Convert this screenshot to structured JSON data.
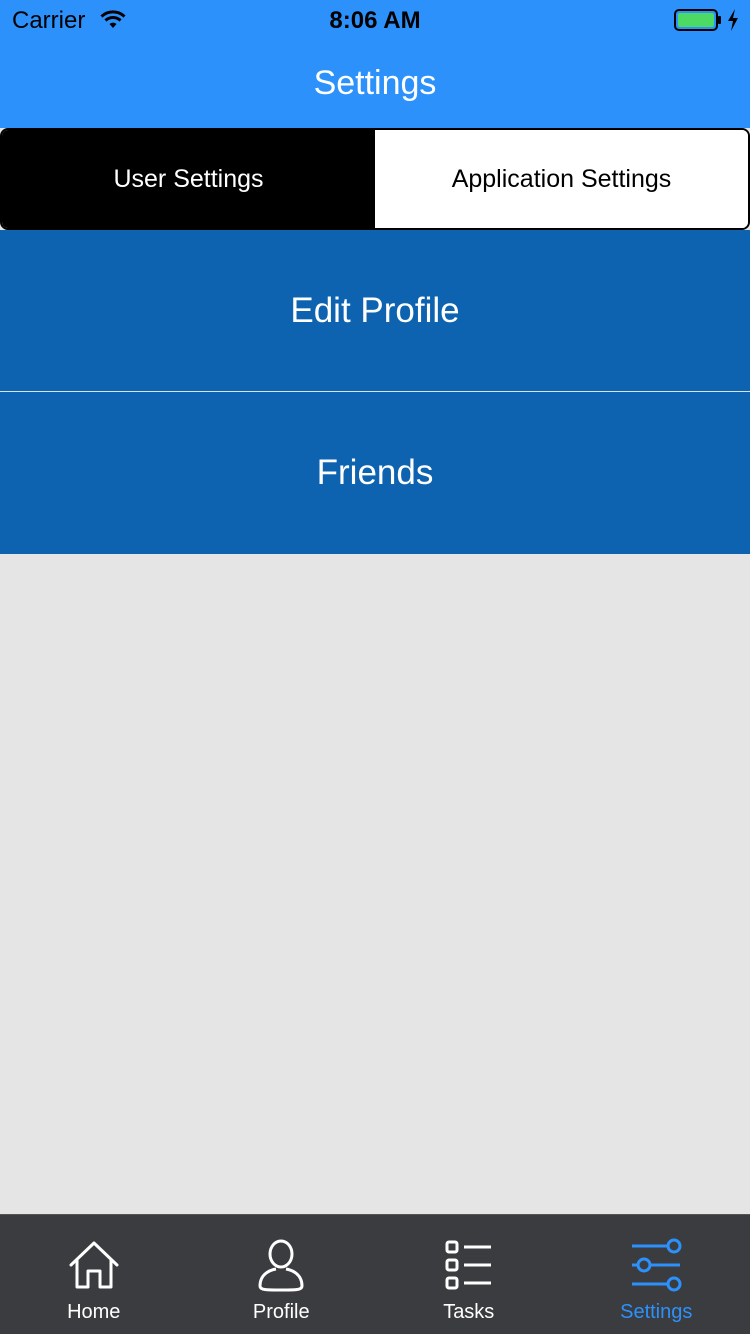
{
  "status_bar": {
    "carrier": "Carrier",
    "time": "8:06 AM",
    "battery_color": "#4cd964"
  },
  "nav": {
    "title": "Settings",
    "bar_color": "#2c91fb"
  },
  "segmented_control": {
    "segments": [
      {
        "label": "User Settings",
        "selected": true
      },
      {
        "label": "Application Settings",
        "selected": false
      }
    ]
  },
  "menu": {
    "items": [
      {
        "label": "Edit Profile"
      },
      {
        "label": "Friends"
      }
    ],
    "row_color": "#0d63b0"
  },
  "tabbar": {
    "items": [
      {
        "label": "Home",
        "icon": "home-icon",
        "active": false
      },
      {
        "label": "Profile",
        "icon": "profile-icon",
        "active": false
      },
      {
        "label": "Tasks",
        "icon": "tasks-icon",
        "active": false
      },
      {
        "label": "Settings",
        "icon": "sliders-icon",
        "active": true
      }
    ],
    "active_color": "#2c91fb"
  }
}
